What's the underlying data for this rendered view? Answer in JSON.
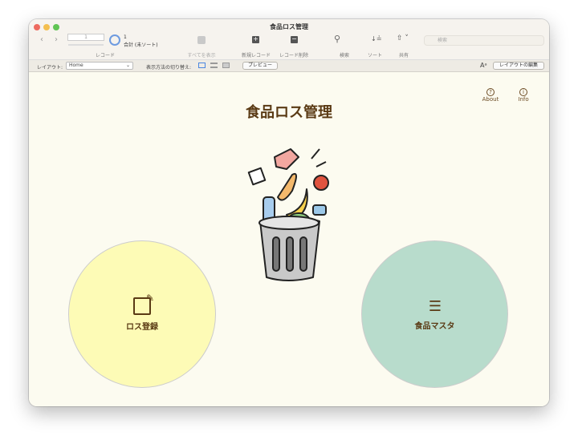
{
  "window": {
    "title": "食品ロス管理"
  },
  "toolbar": {
    "record_value": "1",
    "found": "1",
    "total": "合計 (未ソート)",
    "record_label": "レコード",
    "show_all": "すべてを表示",
    "new_record": "新規レコード",
    "delete_record": "レコード削除",
    "search": "検索",
    "sort": "ソート",
    "share": "共有",
    "search_placeholder": "検索"
  },
  "layoutbar": {
    "layout_label": "レイアウト:",
    "layout_value": "Home",
    "view_switch": "表示方法の切り替え:",
    "preview": "プレビュー",
    "edit_layout": "レイアウトの編集"
  },
  "main": {
    "title": "食品ロス管理",
    "about": "About",
    "info": "Info",
    "loss_register": "ロス登録",
    "food_master": "食品マスタ"
  },
  "colors": {
    "yellow_circle": "#fdfbb6",
    "green_circle": "#b8dccc",
    "title_brown": "#5a3a14"
  }
}
